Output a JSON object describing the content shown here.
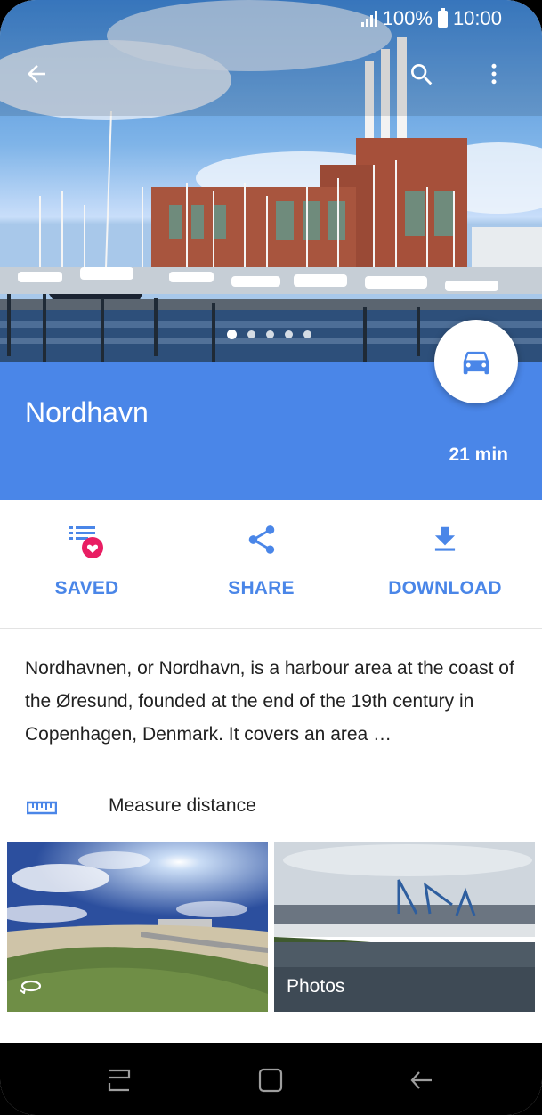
{
  "status_bar": {
    "battery_text": "100%",
    "time": "10:00"
  },
  "header": {
    "back_icon": "arrow-left-icon",
    "search_icon": "search-icon",
    "more_icon": "more-vert-icon"
  },
  "carousel": {
    "total_pages": 5,
    "active_page": 1
  },
  "place": {
    "name": "Nordhavn",
    "travel_time": "21 min",
    "mode_icon": "car-icon"
  },
  "actions": [
    {
      "label": "SAVED",
      "icon": "saved-list-heart-icon"
    },
    {
      "label": "SHARE",
      "icon": "share-icon"
    },
    {
      "label": "DOWNLOAD",
      "icon": "download-icon"
    }
  ],
  "description": "Nordhavnen, or Nordhavn, is a harbour area at the coast of the Øresund, founded at the end of the 19th century in Copenhagen, Denmark. It covers an area …",
  "measure": {
    "label": "Measure distance",
    "icon": "ruler-icon"
  },
  "photos": {
    "label": "Photos",
    "panorama_icon": "360-icon"
  },
  "colors": {
    "accent": "#4a86e8",
    "heart": "#e91e63"
  }
}
